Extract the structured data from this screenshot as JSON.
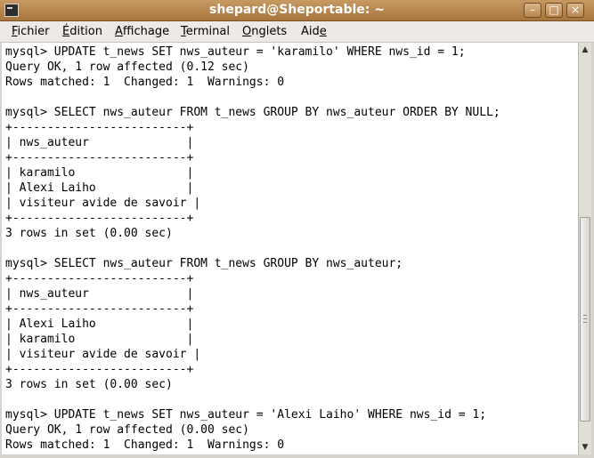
{
  "window": {
    "title": "shepard@Sheportable: ~",
    "buttons": {
      "minimize": "–",
      "maximize": "□",
      "close": "×"
    }
  },
  "menu": [
    {
      "pre": "",
      "u": "F",
      "post": "ichier"
    },
    {
      "pre": "",
      "u": "É",
      "post": "dition"
    },
    {
      "pre": "",
      "u": "A",
      "post": "ffichage"
    },
    {
      "pre": "",
      "u": "T",
      "post": "erminal"
    },
    {
      "pre": "",
      "u": "O",
      "post": "nglets"
    },
    {
      "pre": "Aid",
      "u": "e",
      "post": ""
    }
  ],
  "terminal": {
    "lines": [
      "mysql> UPDATE t_news SET nws_auteur = 'karamilo' WHERE nws_id = 1;",
      "Query OK, 1 row affected (0.12 sec)",
      "Rows matched: 1  Changed: 1  Warnings: 0",
      "",
      "mysql> SELECT nws_auteur FROM t_news GROUP BY nws_auteur ORDER BY NULL;",
      "+-------------------------+",
      "| nws_auteur              |",
      "+-------------------------+",
      "| karamilo                |",
      "| Alexi Laiho             |",
      "| visiteur avide de savoir |",
      "+-------------------------+",
      "3 rows in set (0.00 sec)",
      "",
      "mysql> SELECT nws_auteur FROM t_news GROUP BY nws_auteur;",
      "+-------------------------+",
      "| nws_auteur              |",
      "+-------------------------+",
      "| Alexi Laiho             |",
      "| karamilo                |",
      "| visiteur avide de savoir |",
      "+-------------------------+",
      "3 rows in set (0.00 sec)",
      "",
      "mysql> UPDATE t_news SET nws_auteur = 'Alexi Laiho' WHERE nws_id = 1;",
      "Query OK, 1 row affected (0.00 sec)",
      "Rows matched: 1  Changed: 1  Warnings: 0"
    ]
  },
  "scrollbar": {
    "up_icon": "▲",
    "down_icon": "▼"
  }
}
